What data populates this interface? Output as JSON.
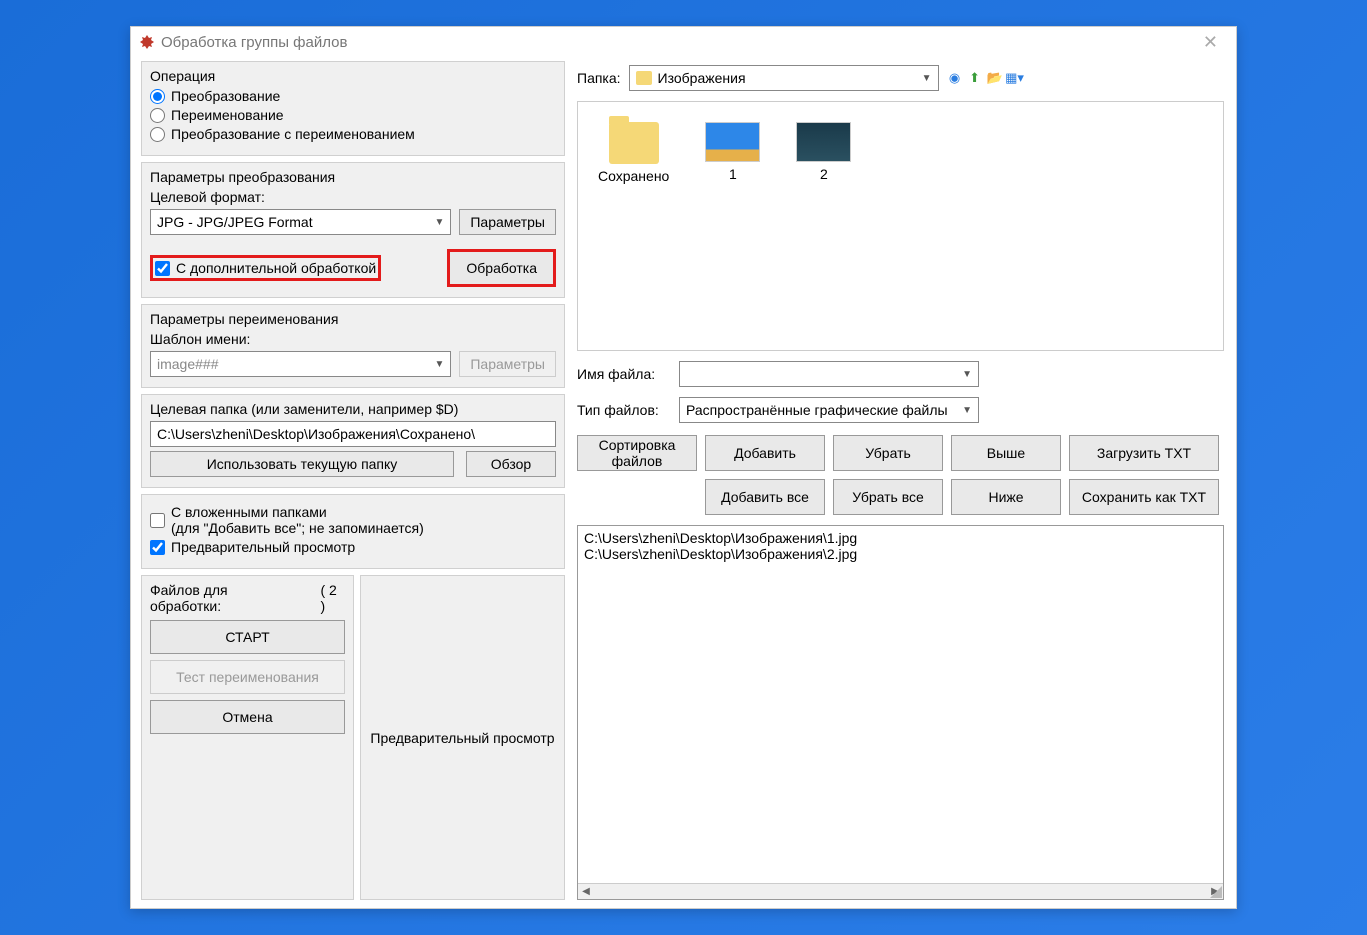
{
  "window": {
    "title": "Обработка группы файлов"
  },
  "operation": {
    "title": "Операция",
    "opt1": "Преобразование",
    "opt2": "Переименование",
    "opt3": "Преобразование с переименованием"
  },
  "conversion": {
    "title": "Параметры преобразования",
    "format_label": "Целевой формат:",
    "format_value": "JPG - JPG/JPEG Format",
    "params_btn": "Параметры",
    "extra_check": "С дополнительной обработкой",
    "process_btn": "Обработка"
  },
  "rename": {
    "title": "Параметры переименования",
    "template_label": "Шаблон имени:",
    "template_value": "image###",
    "params_btn": "Параметры"
  },
  "target_folder": {
    "label": "Целевая папка (или заменители, например $D)",
    "value": "C:\\Users\\zheni\\Desktop\\Изображения\\Сохранено\\",
    "use_current_btn": "Использовать текущую папку",
    "browse_btn": "Обзор"
  },
  "options": {
    "subfolders": "С вложенными папками",
    "subfolders_note": "(для \"Добавить все\"; не запоминается)",
    "preview": "Предварительный просмотр"
  },
  "bottom_left": {
    "files_label": "Файлов для обработки:",
    "count": "( 2 )",
    "start_btn": "СТАРТ",
    "test_btn": "Тест переименования",
    "cancel_btn": "Отмена"
  },
  "preview_pane": "Предварительный просмотр",
  "right": {
    "folder_label": "Папка:",
    "folder_value": "Изображения",
    "thumbs": {
      "t1": "Сохранено",
      "t2": "1",
      "t3": "2"
    },
    "filename_label": "Имя файла:",
    "filetype_label": "Тип файлов:",
    "filetype_value": "Распространённые графические файлы",
    "sort_label": "Сортировка файлов",
    "add_btn": "Добавить",
    "remove_btn": "Убрать",
    "up_btn": "Выше",
    "load_txt_btn": "Загрузить TXT",
    "add_all_btn": "Добавить все",
    "remove_all_btn": "Убрать все",
    "down_btn": "Ниже",
    "save_txt_btn": "Сохранить как TXT",
    "file1": "C:\\Users\\zheni\\Desktop\\Изображения\\1.jpg",
    "file2": "C:\\Users\\zheni\\Desktop\\Изображения\\2.jpg"
  }
}
